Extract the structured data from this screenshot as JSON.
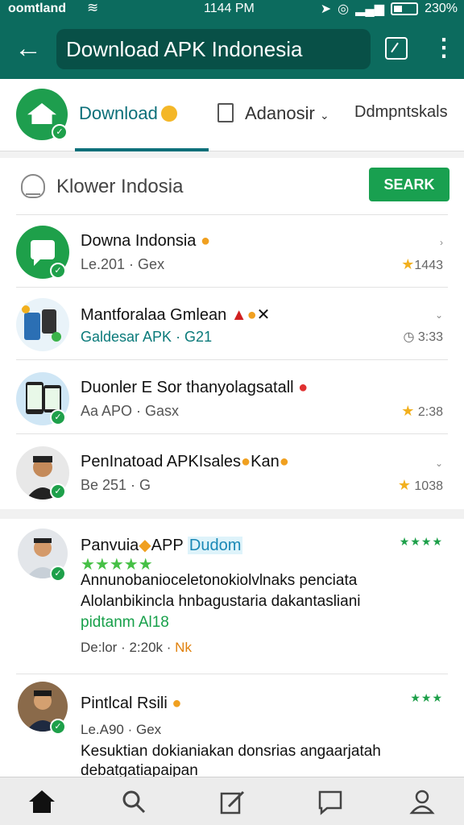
{
  "status_bar": {
    "carrier": "oomtland",
    "time": "1144 PM",
    "battery": "230%"
  },
  "app_bar": {
    "title": "Download APK Indonesia",
    "back_icon": "arrow-left-icon",
    "share_icon": "share-icon",
    "more_icon": "more-vert-icon"
  },
  "tabs": [
    {
      "label": "Download"
    },
    {
      "label": "Adanosir"
    },
    {
      "label": "Ddmpntskals"
    }
  ],
  "search": {
    "text": "Klower Indosia",
    "button": "SEARK"
  },
  "items": [
    {
      "title": "Downa Indonsia",
      "sub": "Le.201 · Gex",
      "meta": "1443"
    },
    {
      "title": "Mantforalaa Gmlean",
      "sub": "Galdesar APK · G21",
      "meta": "3:33"
    },
    {
      "title": "Duonler E Sor thanyolagsatall",
      "sub": "Aa APO · Gasx",
      "meta": "2:38"
    },
    {
      "title": "PenInatoad APKIsales",
      "sub": "Be 251 · G",
      "meta": "1038",
      "extra": "Kan"
    }
  ],
  "reviews": [
    {
      "name": "Panvuia",
      "app": "APP",
      "tag": "Dudom",
      "stars": "★★★★★",
      "rating_top": "★★★★",
      "line1": "Annunobanioceletonokiolvlnaks penciata",
      "line2": "Alolanbikincla hnbagustaria dakantasliani",
      "line3": "pidtanm Al18",
      "meta": "De:lor · 2:20k ·",
      "meta_highlight": "Nk"
    },
    {
      "name": "Pintlcal Rsili",
      "rating_top": "★★★",
      "meta": "Le.A90 · Gex",
      "line1": "Kesuktian dokianiakan donsrias angaarjatah",
      "line2": "debatgatiapaipan"
    }
  ],
  "bottom_nav": [
    {
      "icon": "home-icon"
    },
    {
      "icon": "search-icon"
    },
    {
      "icon": "edit-icon"
    },
    {
      "icon": "chat-icon"
    },
    {
      "icon": "profile-icon"
    }
  ]
}
